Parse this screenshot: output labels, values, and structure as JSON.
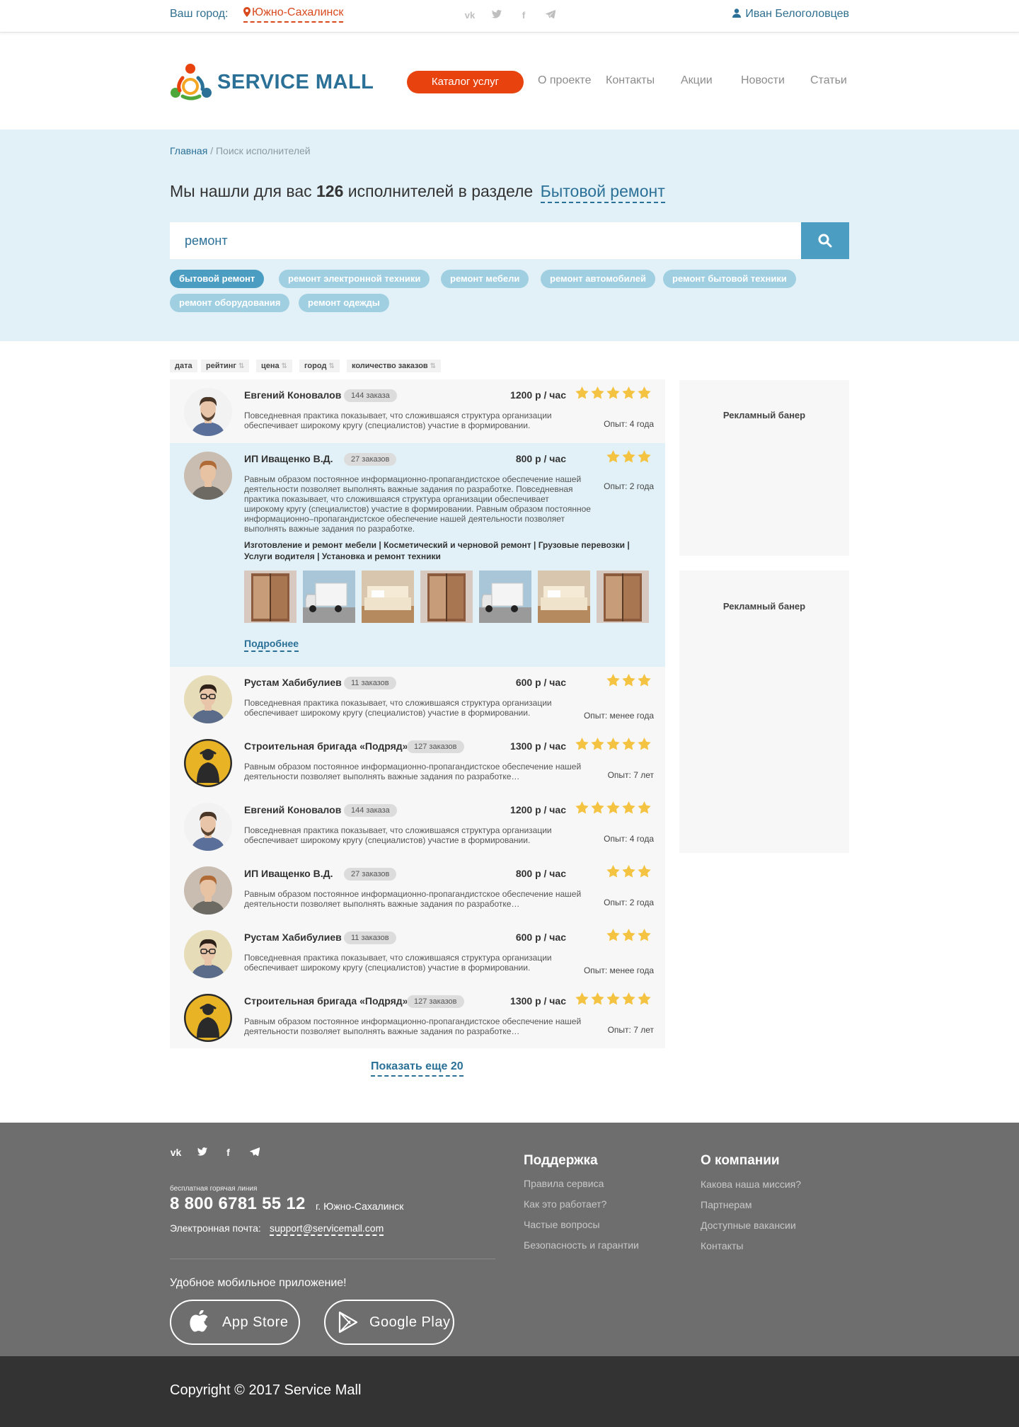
{
  "topbar": {
    "city_label": "Ваш город:",
    "city_value": "Южно-Сахалинск",
    "social": [
      "vk-icon",
      "twitter-icon",
      "facebook-icon",
      "telegram-icon"
    ],
    "user_name": "Иван Белоголовцев"
  },
  "header": {
    "logo_text": "SERVICE MALL",
    "catalog_button": "Каталог услуг",
    "nav": [
      "О проекте",
      "Контакты",
      "Акции",
      "Новости",
      "Статьи"
    ]
  },
  "search": {
    "breadcrumb_home": "Главная",
    "breadcrumb_sep": "/",
    "breadcrumb_current": "Поиск исполнителей",
    "found_prefix": "Мы нашли для вас",
    "found_count": "126",
    "found_suffix": "исполнителей в разделе",
    "found_category": "Бытовой ремонт",
    "query": "ремонт",
    "tags": [
      "бытовой ремонт",
      "ремонт электронной техники",
      "ремонт мебели",
      "ремонт автомобилей",
      "ремонт бытовой техники",
      "ремонт оборудования",
      "ремонт одежды"
    ],
    "active_tag": "бытовой ремонт"
  },
  "sort": [
    "дата",
    "рейтинг",
    "цена",
    "город",
    "количество заказов"
  ],
  "performers": [
    {
      "name": "Евгений Коновалов",
      "orders": "144 заказа",
      "price": "1200 р / час",
      "rating": 5,
      "desc": "Повседневная практика показывает, что сложившаяся структура организации обеспечивает широкому кругу (специалистов) участие в формировании.",
      "experience": "Опыт: 4 года"
    },
    {
      "name": "ИП Иващенко В.Д.",
      "orders": "27 заказов",
      "price": "800 р / час",
      "rating": 3,
      "desc": "Равным образом постоянное информационно-пропагандистское обеспечение нашей деятельности позволяет выполнять важные задания по разработке. Повседневная практика показывает, что сложившаяся структура организации обеспечивает широкому кругу (специалистов) участие в формировании. Равным образом постоянное информационно–пропагандистское обеспечение нашей деятельности позволяет выполнять важные задания по разработке.",
      "experience": "Опыт: 2 года",
      "services": "Изготовление и ремонт мебели  |  Косметический и черновой ремонт  |  Грузовые перевозки  |  Услуги водителя  |  Установка и ремонт техники",
      "more": "Подробнее"
    },
    {
      "name": "Рустам Хабибулиев",
      "orders": "11 заказов",
      "price": "600 р / час",
      "rating": 3,
      "desc": "Повседневная практика показывает, что сложившаяся структура организации обеспечивает широкому кругу (специалистов) участие в формировании.",
      "experience": "Опыт: менее года"
    },
    {
      "name": "Строительная бригада «Подряд»",
      "orders": "127 заказов",
      "price": "1300 р / час",
      "rating": 5,
      "desc": "Равным образом постоянное информационно-пропагандистское обеспечение нашей деятельности позволяет выполнять важные задания по разработке…",
      "experience": "Опыт: 7 лет"
    },
    {
      "name": "Евгений Коновалов",
      "orders": "144 заказа",
      "price": "1200 р / час",
      "rating": 5,
      "desc": "Повседневная практика показывает, что сложившаяся структура организации обеспечивает широкому кругу (специалистов) участие в формировании.",
      "experience": "Опыт: 4 года"
    },
    {
      "name": "ИП Иващенко В.Д.",
      "orders": "27 заказов",
      "price": "800 р / час",
      "rating": 3,
      "desc": "Равным образом постоянное информационно-пропагандистское обеспечение нашей деятельности позволяет выполнять важные задания по разработке…",
      "experience": "Опыт: 2 года"
    },
    {
      "name": "Рустам Хабибулиев",
      "orders": "11 заказов",
      "price": "600 р / час",
      "rating": 3,
      "desc": "Повседневная практика показывает, что сложившаяся структура организации обеспечивает широкому кругу (специалистов) участие в формировании.",
      "experience": "Опыт: менее года"
    },
    {
      "name": "Строительная бригада «Подряд»",
      "orders": "127 заказов",
      "price": "1300 р / час",
      "rating": 5,
      "desc": "Равным образом постоянное информационно-пропагандистское обеспечение нашей деятельности позволяет выполнять важные задания по разработке…",
      "experience": "Опыт: 7 лет"
    }
  ],
  "banners": [
    "Рекламный банер",
    "Рекламный банер"
  ],
  "show_more": "Показать еще 20",
  "footer": {
    "social": [
      "vk-icon",
      "twitter-icon",
      "facebook-icon",
      "telegram-icon"
    ],
    "hotline_label": "бесплатная  горячая линия",
    "phone": "8 800 6781 55 12",
    "phone_city": "г. Южно-Сахалинск",
    "email_label": "Электронная почта:",
    "email": "support@servicemall.com",
    "app_label": "Удобное мобильное приложение!",
    "app_store": "App Store",
    "google_play": "Google Play",
    "support_title": "Поддержка",
    "support_links": [
      "Правила сервиса",
      "Как это работает?",
      "Частые вопросы",
      "Безопасность и гарантии"
    ],
    "company_title": "О компании",
    "company_links": [
      "Какова наша миссия?",
      "Партнерам",
      "Доступные вакансии",
      "Контакты"
    ]
  },
  "copyright": "Copyright © 2017 Service Mall",
  "colors": {
    "accent": "#e8430f",
    "brand": "#2b7097",
    "band": "#e2f1f7",
    "star": "#f5c342"
  }
}
